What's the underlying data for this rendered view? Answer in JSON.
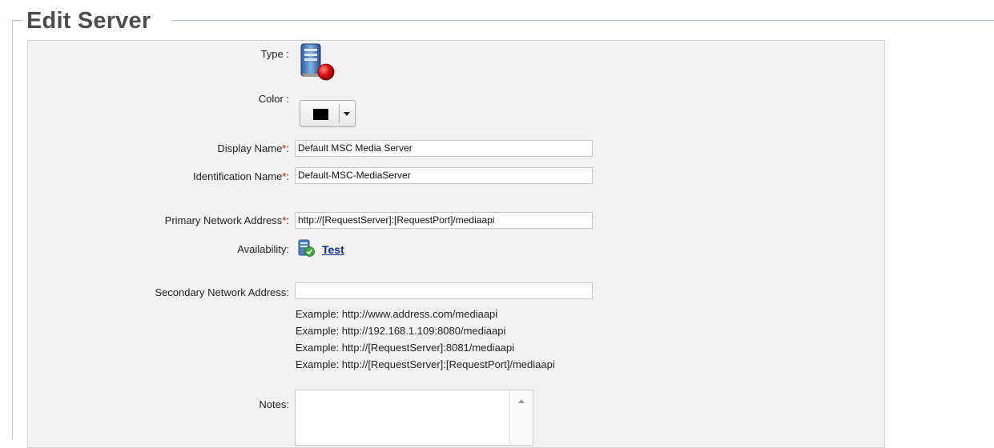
{
  "page": {
    "title": "Edit Server"
  },
  "form": {
    "type_label": "Type :",
    "type_icon": "media-server-icon",
    "color_label": "Color :",
    "color_value": "#000000",
    "display_name_label": "Display Name",
    "display_name_value": "Default MSC Media Server",
    "identification_name_label": "Identification Name",
    "identification_name_value": "Default-MSC-MediaServer",
    "primary_address_label": "Primary Network Address",
    "primary_address_value": "http://[RequestServer]:[RequestPort]/mediaapi",
    "availability_label": "Availability:",
    "availability_icon": "server-check-icon",
    "test_link": "Test",
    "secondary_address_label": "Secondary Network Address:",
    "secondary_address_value": "",
    "required_marker": "*",
    "label_suffix": ":",
    "examples": [
      "Example: http://www.address.com/mediaapi",
      "Example: http://192.168.1.109:8080/mediaapi",
      "Example: http://[RequestServer]:8081/mediaapi",
      "Example: http://[RequestServer]:[RequestPort]/mediaapi"
    ],
    "notes_label": "Notes:",
    "notes_value": ""
  },
  "colors": {
    "frame": "#b8c8e0",
    "panel_background": "#f2f2f2",
    "required": "#cc0000",
    "link": "#0a2a9a"
  }
}
